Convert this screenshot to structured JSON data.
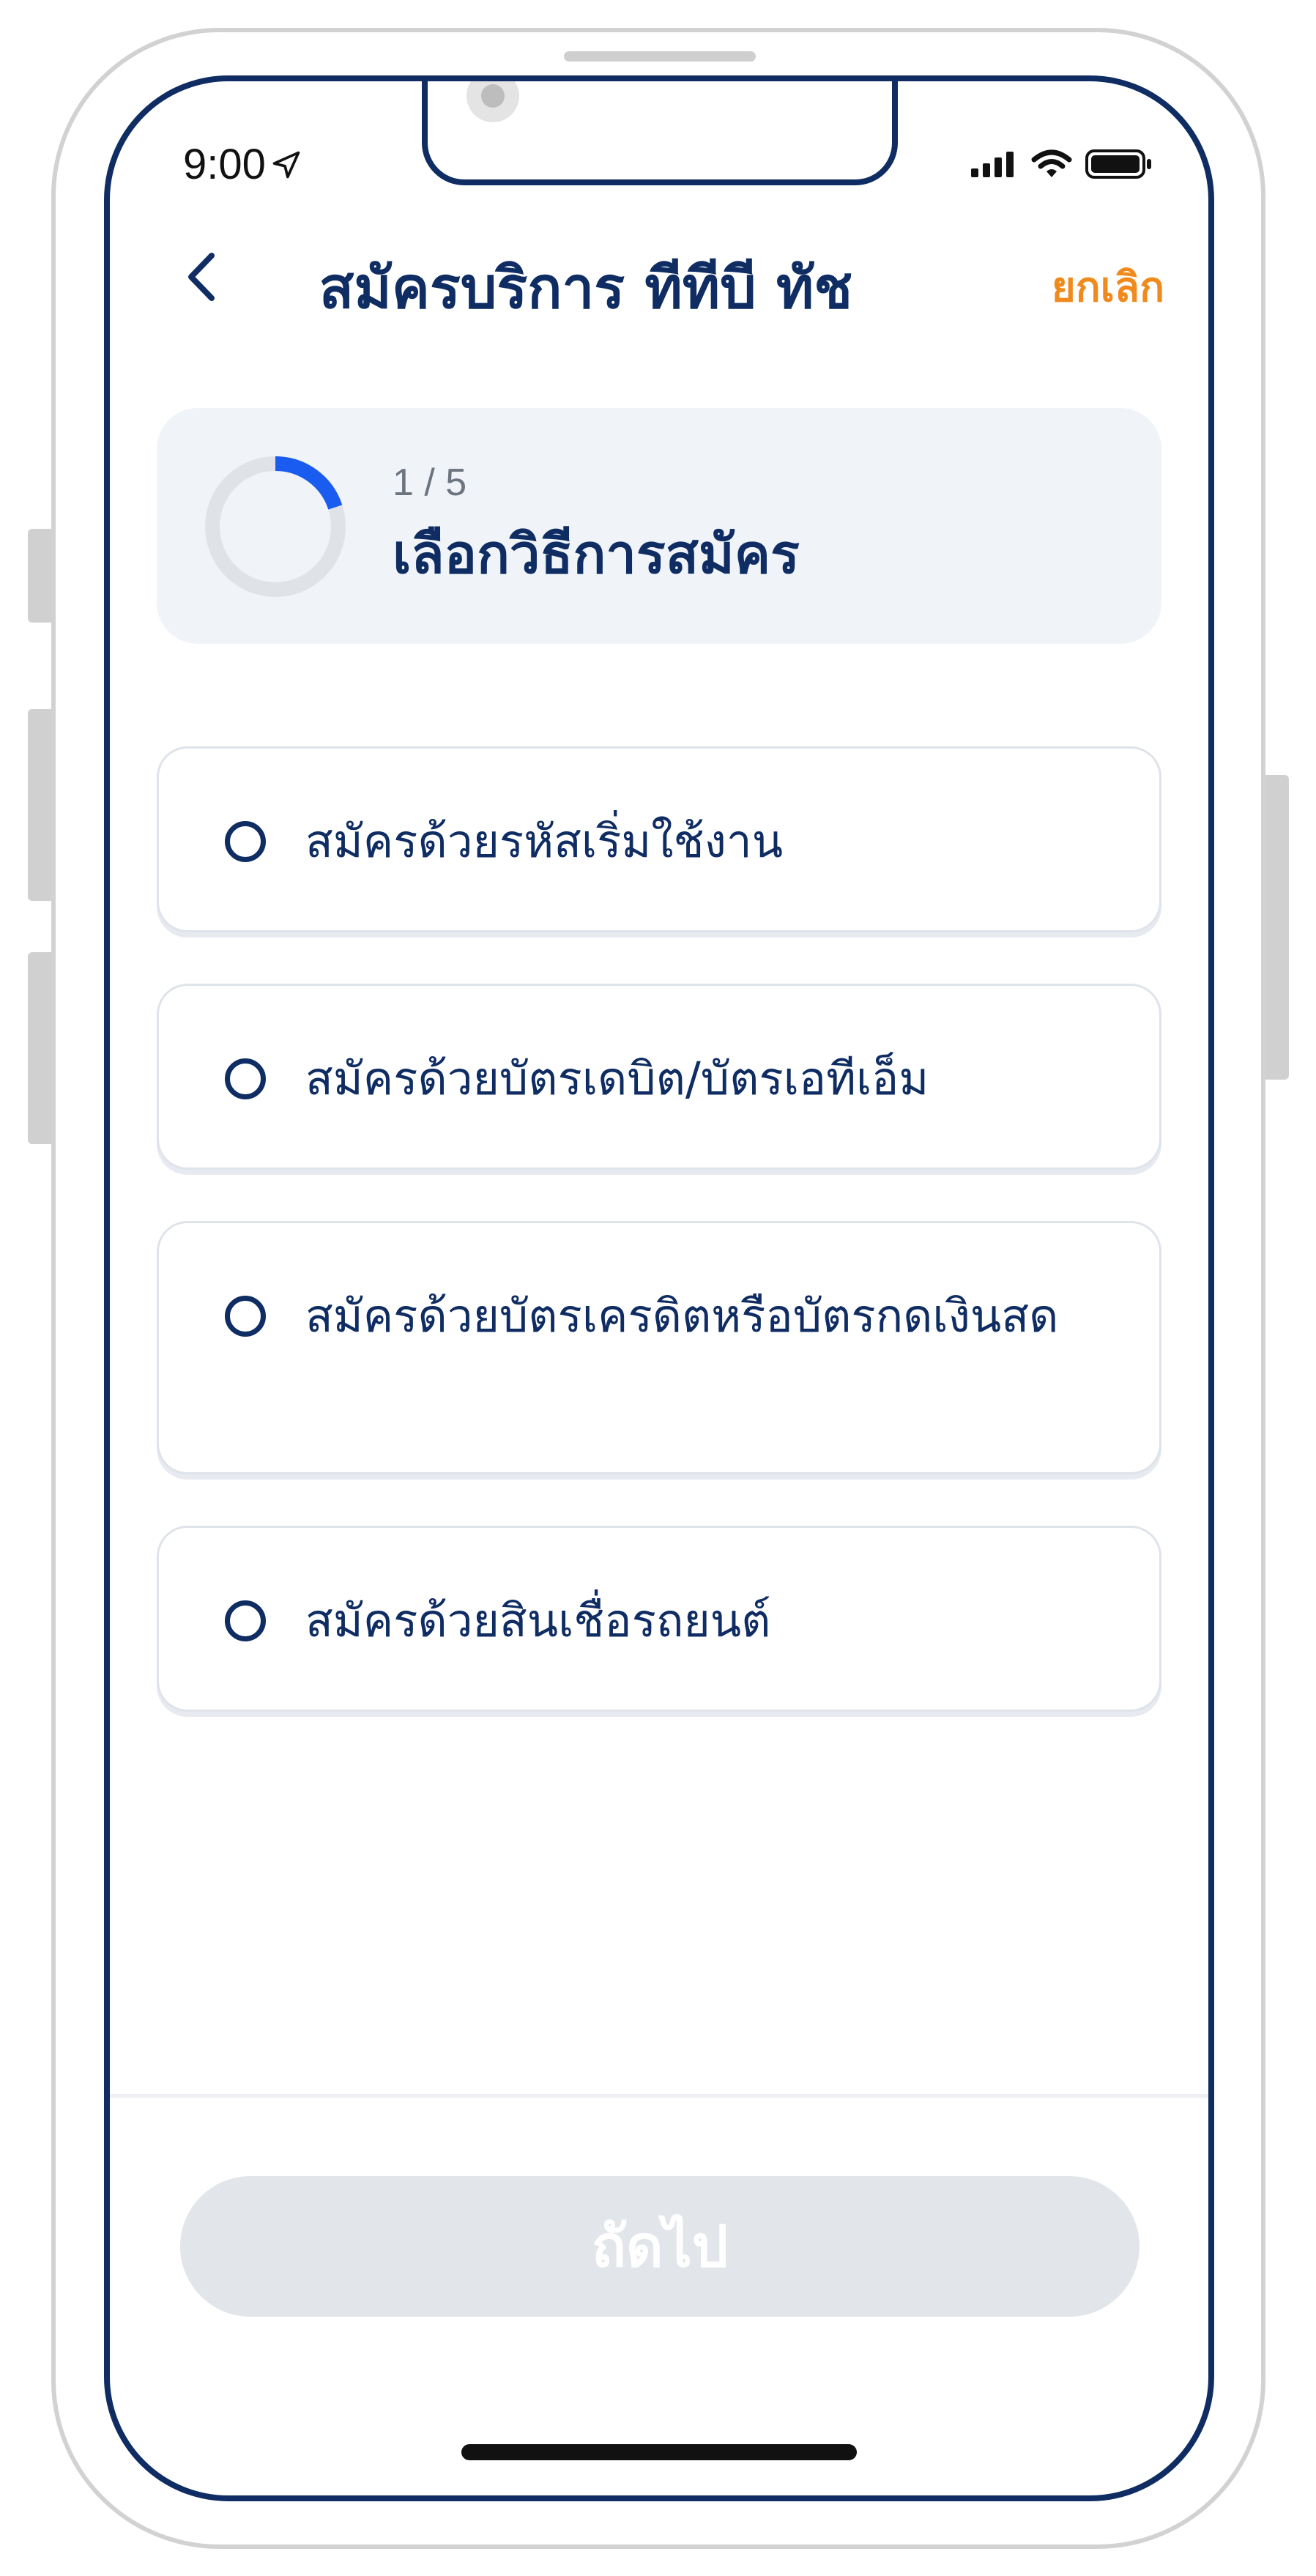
{
  "status_bar": {
    "time": "9:00",
    "icons": [
      "location-arrow-icon",
      "cellular-signal-icon",
      "wifi-icon",
      "battery-icon"
    ]
  },
  "header": {
    "back_icon": "chevron-left-icon",
    "title": "สมัครบริการ ทีทีบี ทัช",
    "cancel_label": "ยกเลิก"
  },
  "step": {
    "count": "1 / 5",
    "title": "เลือกวิธีการสมัคร",
    "progress_fraction": 0.2
  },
  "options": [
    {
      "label": "สมัครด้วยรหัสเริ่มใช้งาน",
      "selected": false
    },
    {
      "label": "สมัครด้วยบัตรเดบิต/บัตรเอทีเอ็ม",
      "selected": false
    },
    {
      "label": "สมัครด้วยบัตรเครดิตหรือบัตรกดเงินสด",
      "selected": false
    },
    {
      "label": "สมัครด้วยสินเชื่อรถยนต์",
      "selected": false
    }
  ],
  "footer": {
    "next_label": "ถัดไป",
    "next_enabled": false
  },
  "colors": {
    "primary": "#0f2d63",
    "accent_orange": "#f08a1c",
    "progress_blue": "#1a5cf0",
    "disabled_button": "#e2e6ea",
    "card_background": "#f0f4f8"
  }
}
